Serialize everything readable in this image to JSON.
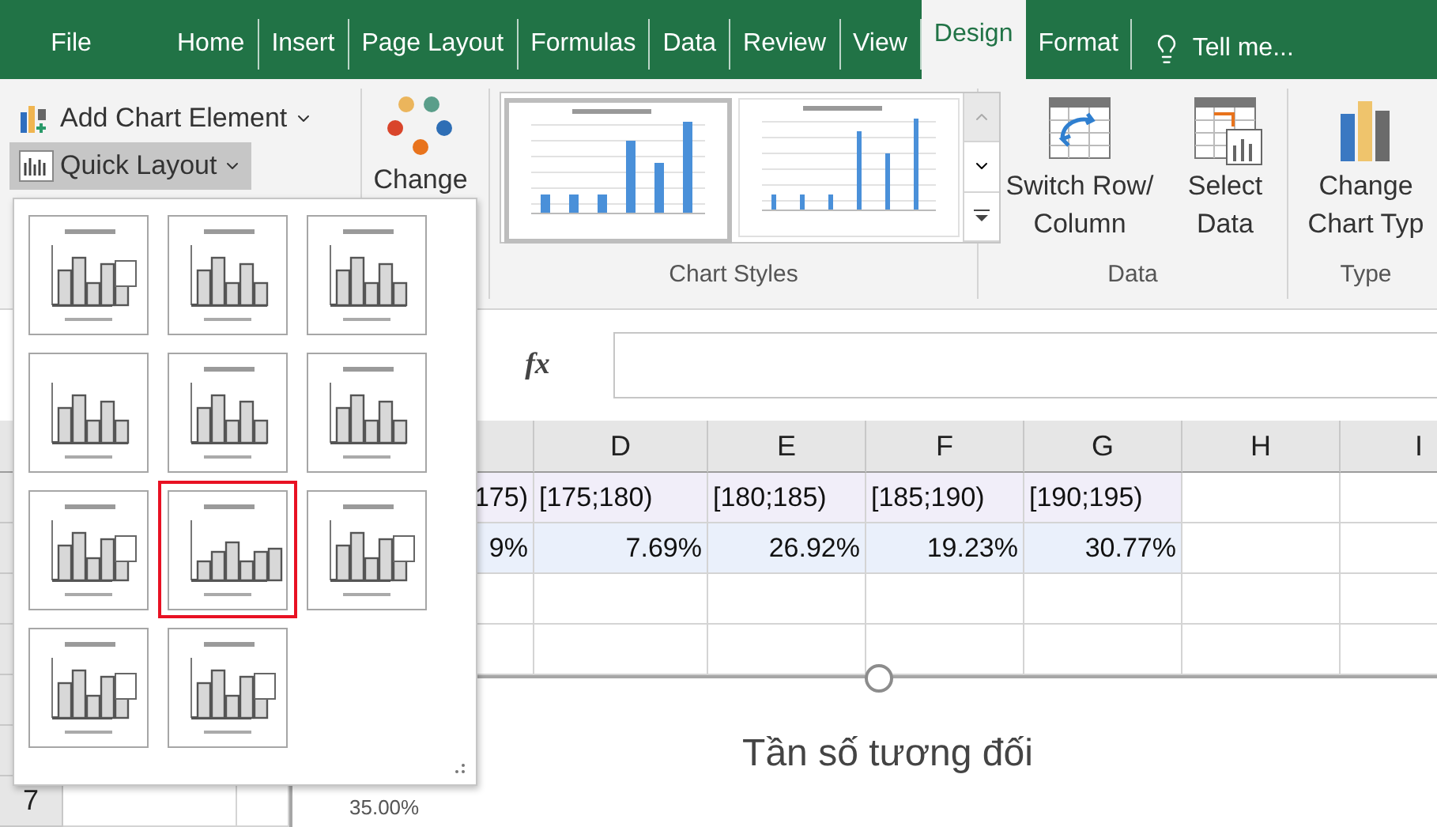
{
  "tabs": [
    {
      "label": "File",
      "selected": false
    },
    {
      "label": "Home",
      "selected": false
    },
    {
      "label": "Insert",
      "selected": false
    },
    {
      "label": "Page Layout",
      "selected": false
    },
    {
      "label": "Formulas",
      "selected": false
    },
    {
      "label": "Data",
      "selected": false
    },
    {
      "label": "Review",
      "selected": false
    },
    {
      "label": "View",
      "selected": false
    },
    {
      "label": "Design",
      "selected": true
    },
    {
      "label": "Format",
      "selected": false
    }
  ],
  "tell_me": "Tell me...",
  "ribbon": {
    "add_chart_element": "Add Chart Element",
    "quick_layout": {
      "label": "Quick Layout",
      "expanded": true
    },
    "change_colors": "Change",
    "chart_styles": {
      "label": "Chart Styles"
    },
    "data_group": {
      "label": "Data",
      "buttons": [
        "Switch Row/ Column",
        "Select Data"
      ]
    },
    "type_group": {
      "label": "Type",
      "buttons": [
        "Change Chart Typ"
      ]
    }
  },
  "quick_layout_menu": {
    "items": [
      {
        "selected": false
      },
      {
        "selected": false
      },
      {
        "selected": false
      },
      {
        "selected": false
      },
      {
        "selected": false
      },
      {
        "selected": false
      },
      {
        "selected": false
      },
      {
        "selected": true
      },
      {
        "selected": false
      },
      {
        "selected": false
      },
      {
        "selected": false
      }
    ]
  },
  "formula_bar": {
    "function_label": "fx"
  },
  "sheet": {
    "columns": [
      "",
      "D",
      "E",
      "F",
      "G",
      "H",
      "I"
    ],
    "rows": [
      {
        "cells": [
          "175)",
          "[175;180)",
          "[180;185)",
          "[185;190)",
          "[190;195)",
          "",
          ""
        ]
      },
      {
        "cells": [
          "9%",
          "7.69%",
          "26.92%",
          "19.23%",
          "30.77%",
          "",
          ""
        ]
      }
    ],
    "row_header": "7"
  },
  "chart": {
    "title": "Tần số tương đối",
    "y_tick": "35.00%"
  }
}
